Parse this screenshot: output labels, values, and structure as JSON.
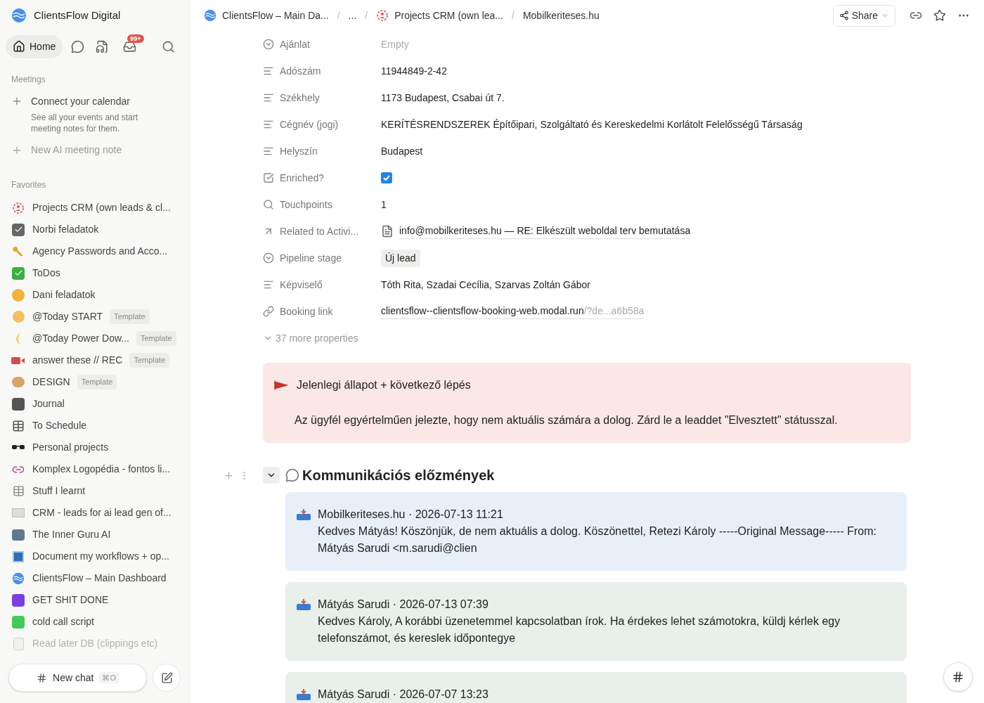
{
  "workspace": {
    "name": "ClientsFlow Digital"
  },
  "nav": {
    "home": "Home",
    "inbox_badge": "99+"
  },
  "meetings": {
    "heading": "Meetings",
    "connect_title": "Connect your calendar",
    "connect_desc": "See all your events and start meeting notes for them.",
    "new_note": "New AI meeting note"
  },
  "favorites": {
    "heading": "Favorites",
    "items": [
      {
        "label": "Projects CRM (own leads & cl...",
        "faded": false
      },
      {
        "label": "Norbi feladatok",
        "faded": false
      },
      {
        "label": "Agency Passwords and Acco...",
        "faded": false
      },
      {
        "label": "ToDos",
        "faded": false
      },
      {
        "label": "Dani feladatok",
        "faded": false
      },
      {
        "label": "@Today START",
        "badge": "Template",
        "faded": false
      },
      {
        "label": "@Today Power Dow...",
        "badge": "Template",
        "faded": false
      },
      {
        "label": "answer these // REC",
        "badge": "Template",
        "faded": false
      },
      {
        "label": "DESIGN",
        "badge": "Template",
        "faded": false
      },
      {
        "label": "Journal",
        "faded": false
      },
      {
        "label": "To Schedule",
        "faded": false
      },
      {
        "label": "Personal projects",
        "faded": false
      },
      {
        "label": "Komplex Logopédia - fontos li...",
        "faded": false
      },
      {
        "label": "Stuff I learnt",
        "faded": false
      },
      {
        "label": "CRM - leads for ai lead gen of...",
        "faded": false
      },
      {
        "label": "The Inner Guru AI",
        "faded": false
      },
      {
        "label": "Document my workflows + op...",
        "faded": false
      },
      {
        "label": "ClientsFlow – Main Dashboard",
        "faded": false
      },
      {
        "label": "GET SHIT DONE",
        "faded": false
      },
      {
        "label": "cold call script",
        "faded": false
      },
      {
        "label": "Read later DB (clippings etc)",
        "faded": true
      }
    ]
  },
  "new_chat": {
    "label": "New chat",
    "shortcut": "⌘O"
  },
  "breadcrumbs": [
    "ClientsFlow – Main Da...",
    "...",
    "Projects CRM (own lea...",
    "Mobilkeriteses.hu"
  ],
  "breadcrumb_separator": "/",
  "share": "Share",
  "properties": [
    {
      "kind": "empty",
      "name": "Ajánlat",
      "value": "Empty"
    },
    {
      "kind": "text",
      "name": "Adószám",
      "value": "11944849-2-42"
    },
    {
      "kind": "text",
      "name": "Székhely",
      "value": "1173 Budapest, Csabai út 7."
    },
    {
      "kind": "text",
      "name": "Cégnév (jogi)",
      "value": "KERÍTÉSRENDSZEREK Építőipari, Szolgáltató és Kereskedelmi Korlátolt Felelősségű Társaság"
    },
    {
      "kind": "text",
      "name": "Helyszín",
      "value": "Budapest"
    },
    {
      "kind": "checkbox",
      "name": "Enriched?",
      "checked": true
    },
    {
      "kind": "text",
      "name": "Touchpoints",
      "value": "1"
    },
    {
      "kind": "relation",
      "name": "Related to Activi...",
      "value": "info@mobilkeriteses.hu — RE: Elkészült weboldal terv bemutatása"
    },
    {
      "kind": "tag",
      "name": "Pipeline stage",
      "value": "Új lead"
    },
    {
      "kind": "text",
      "name": "Képviselő",
      "value": "Tóth Rita, Szadai Cecília, Szarvas Zoltán Gábor"
    },
    {
      "kind": "url",
      "name": "Booking link",
      "value": "clientsflow--clientsflow-booking-web.modal.run",
      "rest": "/?de...a6b58a"
    }
  ],
  "more_properties": "37 more properties",
  "callout": {
    "title": "Jelenlegi állapot + következő lépés",
    "body": "Az ügyfél egyértelműen jelezte, hogy nem aktuális számára a dolog. Zárd le a leaddet \"Elvesztett\" státusszal."
  },
  "section": {
    "title": "Kommunikációs előzmények",
    "expanded": true
  },
  "messages": [
    {
      "kind": "incoming",
      "header": "Mobilkeriteses.hu · 2026-07-13 11:21",
      "body": "Kedves Mátyás! Köszönjük, de nem aktuális a dolog. Köszönettel, Retezi Károly -----Original Message----- From: Mátyás Sarudi <m.sarudi@clien"
    },
    {
      "kind": "outgoing",
      "header": "Mátyás Sarudi · 2026-07-13 07:39",
      "body": "Kedves Károly, A korábbi üzenetemmel kapcsolatban írok. Ha érdekes lehet számotokra, küldj kérlek egy telefonszámot, és kereslek időpontegye"
    },
    {
      "kind": "outgoing",
      "header": "Mátyás Sarudi · 2026-07-07 13:23"
    }
  ]
}
